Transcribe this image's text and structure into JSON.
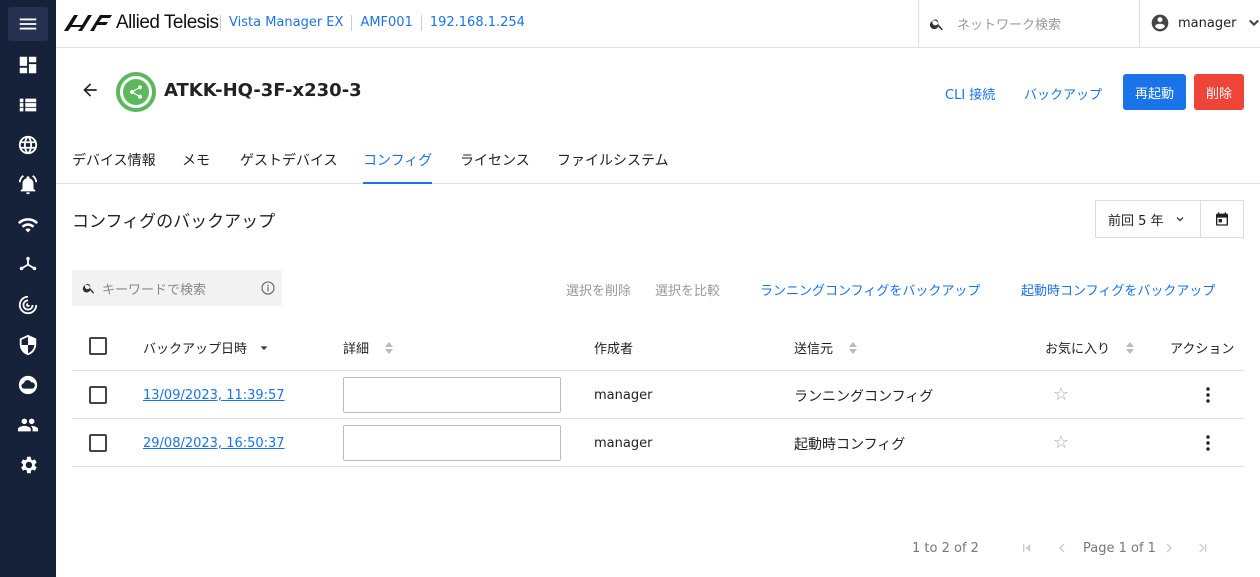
{
  "topbar": {
    "brand": "Allied Telesis",
    "breadcrumb": [
      "Vista Manager EX",
      "AMF001",
      "192.168.1.254"
    ],
    "search_placeholder": "ネットワーク検索",
    "user": "manager"
  },
  "device": {
    "name": "ATKK-HQ-3F-x230-3",
    "actions": {
      "cli": "CLI 接続",
      "backup": "バックアップ",
      "reboot": "再起動",
      "delete": "削除"
    }
  },
  "tabs": [
    "デバイス情報",
    "メモ",
    "ゲストデバイス",
    "コンフィグ",
    "ライセンス",
    "ファイルシステム"
  ],
  "active_tab": "コンフィグ",
  "section": {
    "title": "コンフィグのバックアップ",
    "period": "前回 5 年"
  },
  "toolbar": {
    "search_placeholder": "キーワードで検索",
    "delete_selected": "選択を削除",
    "compare_selected": "選択を比較",
    "backup_running": "ランニングコンフィグをバックアップ",
    "backup_startup": "起動時コンフィグをバックアップ"
  },
  "table": {
    "headers": {
      "date": "バックアップ日時",
      "detail": "詳細",
      "author": "作成者",
      "source": "送信元",
      "favorite": "お気に入り",
      "action": "アクション"
    },
    "rows": [
      {
        "date": "13/09/2023, 11:39:57",
        "detail": "",
        "author": "manager",
        "source": "ランニングコンフィグ",
        "favorite": false
      },
      {
        "date": "29/08/2023, 16:50:37",
        "detail": "",
        "author": "manager",
        "source": "起動時コンフィグ",
        "favorite": false
      }
    ]
  },
  "pagination": {
    "range": "1 to 2 of 2",
    "page": "Page 1 of 1"
  },
  "colors": {
    "sidebar": "#16213a",
    "accent": "#1a73e8",
    "danger": "#ef4438",
    "device_ok": "#5cb85c"
  }
}
